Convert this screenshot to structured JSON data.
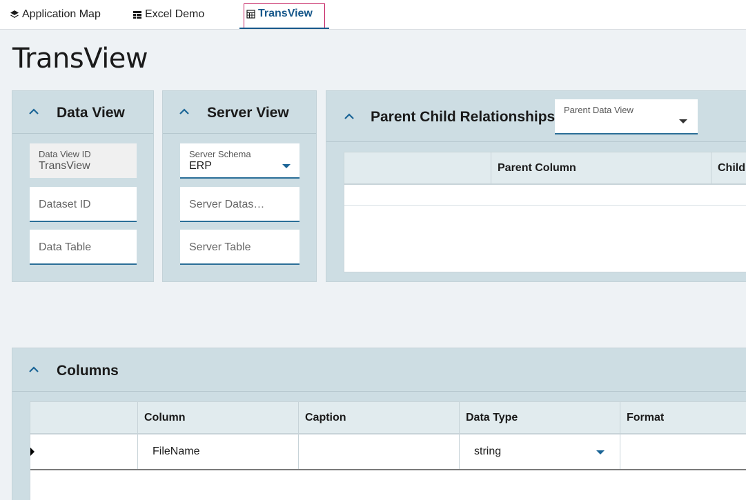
{
  "tabs": [
    {
      "label": "Application Map",
      "icon": "layers-icon"
    },
    {
      "label": "Excel Demo",
      "icon": "table-layout-icon"
    },
    {
      "label": "TransView",
      "icon": "grid-icon",
      "active": true
    }
  ],
  "page_title": "TransView",
  "data_view": {
    "title": "Data View",
    "data_view_id_label": "Data View ID",
    "data_view_id_value": "TransView",
    "dataset_id_placeholder": "Dataset ID",
    "data_table_placeholder": "Data Table"
  },
  "server_view": {
    "title": "Server View",
    "schema_label": "Server Schema",
    "schema_value": "ERP",
    "dataset_placeholder": "Server Datas…",
    "table_placeholder": "Server Table"
  },
  "relationships": {
    "title": "Parent Child Relationships",
    "parent_data_view_label": "Parent Data View",
    "columns": [
      "",
      "Parent Column",
      "Child"
    ]
  },
  "columns_panel": {
    "title": "Columns",
    "headers": [
      "",
      "Column",
      "Caption",
      "Data Type",
      "Format"
    ],
    "rows": [
      {
        "column": "FileName",
        "caption": "",
        "data_type": "string",
        "format": ""
      }
    ]
  },
  "colors": {
    "accent": "#16578a",
    "panel_bg": "#cddde3",
    "page_bg": "#eef2f5",
    "focus_outline": "#c2185b"
  }
}
